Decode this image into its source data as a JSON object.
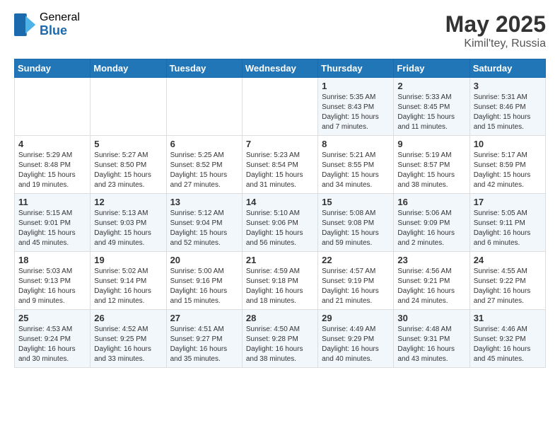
{
  "header": {
    "logo_general": "General",
    "logo_blue": "Blue",
    "title": "May 2025",
    "subtitle": "Kimil'tey, Russia"
  },
  "days_of_week": [
    "Sunday",
    "Monday",
    "Tuesday",
    "Wednesday",
    "Thursday",
    "Friday",
    "Saturday"
  ],
  "weeks": [
    {
      "days": [
        {
          "number": "",
          "info": ""
        },
        {
          "number": "",
          "info": ""
        },
        {
          "number": "",
          "info": ""
        },
        {
          "number": "",
          "info": ""
        },
        {
          "number": "1",
          "info": "Sunrise: 5:35 AM\nSunset: 8:43 PM\nDaylight: 15 hours\nand 7 minutes."
        },
        {
          "number": "2",
          "info": "Sunrise: 5:33 AM\nSunset: 8:45 PM\nDaylight: 15 hours\nand 11 minutes."
        },
        {
          "number": "3",
          "info": "Sunrise: 5:31 AM\nSunset: 8:46 PM\nDaylight: 15 hours\nand 15 minutes."
        }
      ]
    },
    {
      "days": [
        {
          "number": "4",
          "info": "Sunrise: 5:29 AM\nSunset: 8:48 PM\nDaylight: 15 hours\nand 19 minutes."
        },
        {
          "number": "5",
          "info": "Sunrise: 5:27 AM\nSunset: 8:50 PM\nDaylight: 15 hours\nand 23 minutes."
        },
        {
          "number": "6",
          "info": "Sunrise: 5:25 AM\nSunset: 8:52 PM\nDaylight: 15 hours\nand 27 minutes."
        },
        {
          "number": "7",
          "info": "Sunrise: 5:23 AM\nSunset: 8:54 PM\nDaylight: 15 hours\nand 31 minutes."
        },
        {
          "number": "8",
          "info": "Sunrise: 5:21 AM\nSunset: 8:55 PM\nDaylight: 15 hours\nand 34 minutes."
        },
        {
          "number": "9",
          "info": "Sunrise: 5:19 AM\nSunset: 8:57 PM\nDaylight: 15 hours\nand 38 minutes."
        },
        {
          "number": "10",
          "info": "Sunrise: 5:17 AM\nSunset: 8:59 PM\nDaylight: 15 hours\nand 42 minutes."
        }
      ]
    },
    {
      "days": [
        {
          "number": "11",
          "info": "Sunrise: 5:15 AM\nSunset: 9:01 PM\nDaylight: 15 hours\nand 45 minutes."
        },
        {
          "number": "12",
          "info": "Sunrise: 5:13 AM\nSunset: 9:03 PM\nDaylight: 15 hours\nand 49 minutes."
        },
        {
          "number": "13",
          "info": "Sunrise: 5:12 AM\nSunset: 9:04 PM\nDaylight: 15 hours\nand 52 minutes."
        },
        {
          "number": "14",
          "info": "Sunrise: 5:10 AM\nSunset: 9:06 PM\nDaylight: 15 hours\nand 56 minutes."
        },
        {
          "number": "15",
          "info": "Sunrise: 5:08 AM\nSunset: 9:08 PM\nDaylight: 15 hours\nand 59 minutes."
        },
        {
          "number": "16",
          "info": "Sunrise: 5:06 AM\nSunset: 9:09 PM\nDaylight: 16 hours\nand 2 minutes."
        },
        {
          "number": "17",
          "info": "Sunrise: 5:05 AM\nSunset: 9:11 PM\nDaylight: 16 hours\nand 6 minutes."
        }
      ]
    },
    {
      "days": [
        {
          "number": "18",
          "info": "Sunrise: 5:03 AM\nSunset: 9:13 PM\nDaylight: 16 hours\nand 9 minutes."
        },
        {
          "number": "19",
          "info": "Sunrise: 5:02 AM\nSunset: 9:14 PM\nDaylight: 16 hours\nand 12 minutes."
        },
        {
          "number": "20",
          "info": "Sunrise: 5:00 AM\nSunset: 9:16 PM\nDaylight: 16 hours\nand 15 minutes."
        },
        {
          "number": "21",
          "info": "Sunrise: 4:59 AM\nSunset: 9:18 PM\nDaylight: 16 hours\nand 18 minutes."
        },
        {
          "number": "22",
          "info": "Sunrise: 4:57 AM\nSunset: 9:19 PM\nDaylight: 16 hours\nand 21 minutes."
        },
        {
          "number": "23",
          "info": "Sunrise: 4:56 AM\nSunset: 9:21 PM\nDaylight: 16 hours\nand 24 minutes."
        },
        {
          "number": "24",
          "info": "Sunrise: 4:55 AM\nSunset: 9:22 PM\nDaylight: 16 hours\nand 27 minutes."
        }
      ]
    },
    {
      "days": [
        {
          "number": "25",
          "info": "Sunrise: 4:53 AM\nSunset: 9:24 PM\nDaylight: 16 hours\nand 30 minutes."
        },
        {
          "number": "26",
          "info": "Sunrise: 4:52 AM\nSunset: 9:25 PM\nDaylight: 16 hours\nand 33 minutes."
        },
        {
          "number": "27",
          "info": "Sunrise: 4:51 AM\nSunset: 9:27 PM\nDaylight: 16 hours\nand 35 minutes."
        },
        {
          "number": "28",
          "info": "Sunrise: 4:50 AM\nSunset: 9:28 PM\nDaylight: 16 hours\nand 38 minutes."
        },
        {
          "number": "29",
          "info": "Sunrise: 4:49 AM\nSunset: 9:29 PM\nDaylight: 16 hours\nand 40 minutes."
        },
        {
          "number": "30",
          "info": "Sunrise: 4:48 AM\nSunset: 9:31 PM\nDaylight: 16 hours\nand 43 minutes."
        },
        {
          "number": "31",
          "info": "Sunrise: 4:46 AM\nSunset: 9:32 PM\nDaylight: 16 hours\nand 45 minutes."
        }
      ]
    }
  ]
}
